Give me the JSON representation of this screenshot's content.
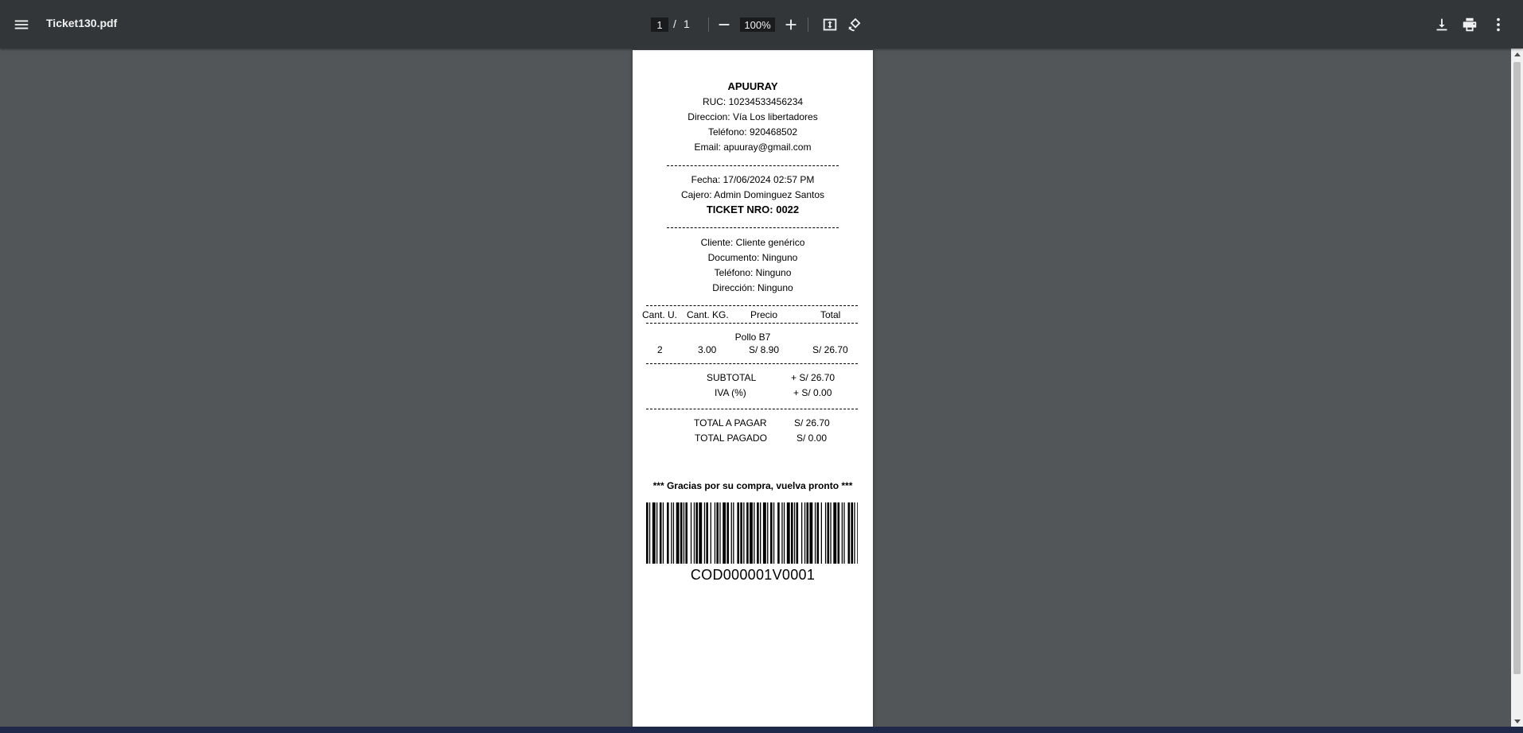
{
  "toolbar": {
    "title": "Ticket130.pdf",
    "current_page": "1",
    "page_separator": "/",
    "total_pages": "1",
    "zoom": "100%"
  },
  "receipt": {
    "company": "APUURAY",
    "ruc": "RUC: 10234533456234",
    "address": "Direccion: Vía Los libertadores",
    "phone": "Teléfono: 920468502",
    "email": "Email: apuuray@gmail.com",
    "date": "Fecha: 17/06/2024 02:57 PM",
    "cashier": "Cajero: Admin Dominguez Santos",
    "ticket_number": "TICKET NRO: 0022",
    "client": "Cliente: Cliente genérico",
    "document": "Documento: Ninguno",
    "client_phone": "Teléfono: Ninguno",
    "client_address": "Dirección: Ninguno",
    "columns": [
      "Cant. U.",
      "Cant. KG.",
      "Precio",
      "Total"
    ],
    "items": [
      {
        "name": "Pollo B7",
        "qty_units": "2",
        "qty_kg": "3.00",
        "price": "S/ 8.90",
        "total": "S/ 26.70"
      }
    ],
    "subtotal_label": "SUBTOTAL",
    "subtotal_value": "+ S/ 26.70",
    "tax_label": "IVA (%)",
    "tax_value": "+ S/ 0.00",
    "total_to_pay_label": "TOTAL A PAGAR",
    "total_to_pay_value": "S/ 26.70",
    "total_paid_label": "TOTAL PAGADO",
    "total_paid_value": "S/ 0.00",
    "thanks": "*** Gracias por su compra, vuelva pronto ***",
    "barcode_code": "COD000001V0001"
  }
}
